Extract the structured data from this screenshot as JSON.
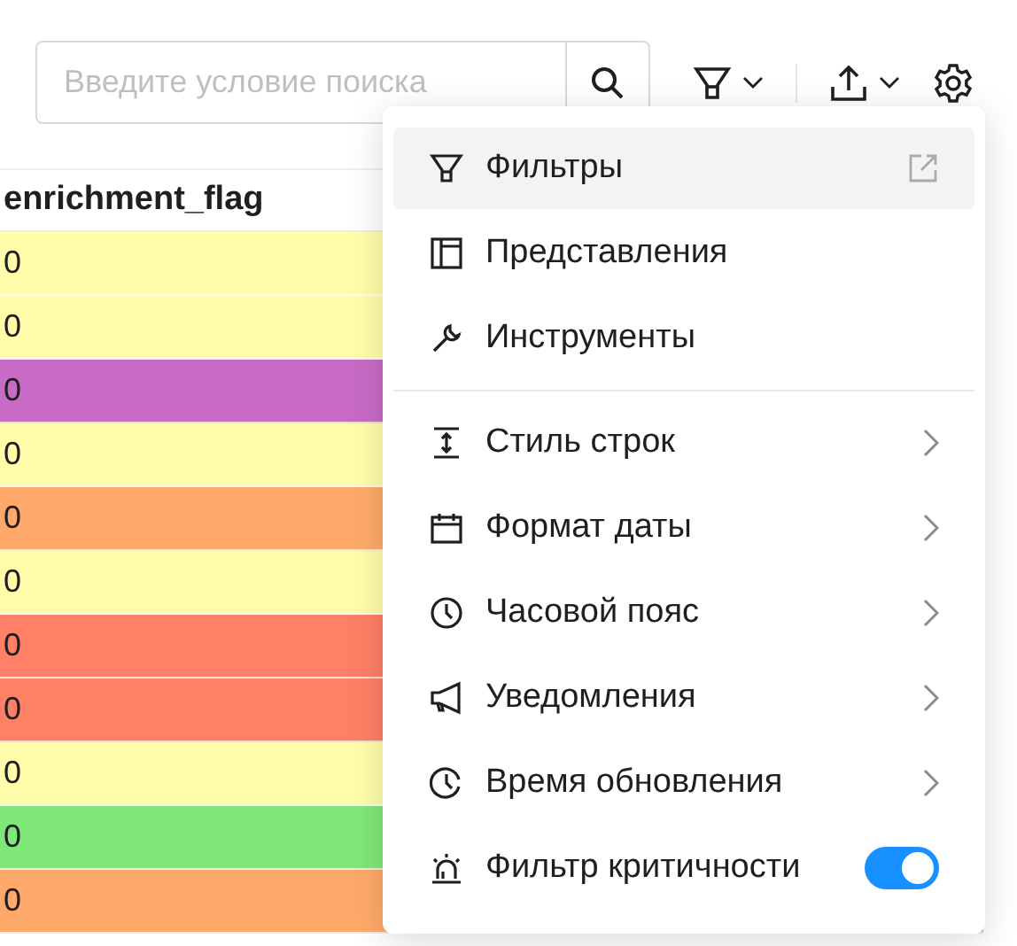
{
  "toolbar": {
    "search": {
      "placeholder": "Введите условие поиска"
    }
  },
  "table": {
    "columns": [
      "enrichment_flag"
    ],
    "rows": [
      {
        "value": "0",
        "color": "#fffdaa"
      },
      {
        "value": "0",
        "color": "#fffdaa"
      },
      {
        "value": "0",
        "color": "#c86bc6"
      },
      {
        "value": "0",
        "color": "#fffdaa"
      },
      {
        "value": "0",
        "color": "#ffaa6a"
      },
      {
        "value": "0",
        "color": "#fffdaa"
      },
      {
        "value": "0",
        "color": "#ff8066"
      },
      {
        "value": "0",
        "color": "#ff8066"
      },
      {
        "value": "0",
        "color": "#fffdaa"
      },
      {
        "value": "0",
        "color": "#80e878"
      },
      {
        "value": "0",
        "color": "#ffaa6a"
      }
    ]
  },
  "settings_menu": {
    "items": [
      {
        "kind": "external",
        "label": "Фильтры",
        "selected": true
      },
      {
        "kind": "plain",
        "label": "Представления",
        "selected": false
      },
      {
        "kind": "plain",
        "label": "Инструменты",
        "selected": false
      },
      {
        "kind": "divider"
      },
      {
        "kind": "submenu",
        "label": "Стиль строк",
        "selected": false
      },
      {
        "kind": "submenu",
        "label": "Формат даты",
        "selected": false
      },
      {
        "kind": "submenu",
        "label": "Часовой пояс",
        "selected": false
      },
      {
        "kind": "submenu",
        "label": "Уведомления",
        "selected": false
      },
      {
        "kind": "submenu",
        "label": "Время обновления",
        "selected": false
      },
      {
        "kind": "toggle",
        "label": "Фильтр критичности",
        "on": true
      }
    ]
  }
}
